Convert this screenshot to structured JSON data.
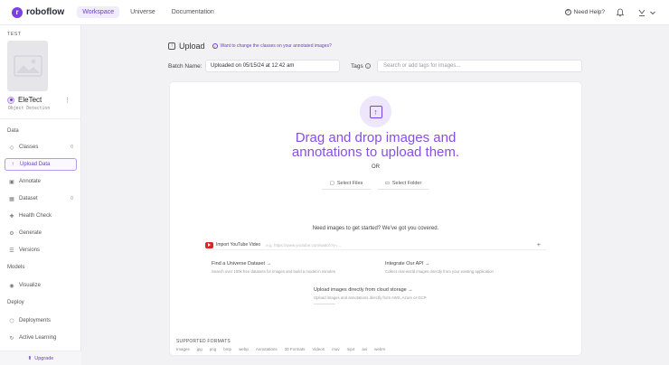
{
  "app": {
    "logo_text": "roboflow",
    "brand_color": "#7b3fe4"
  },
  "nav": {
    "tabs": [
      {
        "label": "Workspace",
        "active": true
      },
      {
        "label": "Universe",
        "active": false
      },
      {
        "label": "Documentation",
        "active": false
      }
    ],
    "help_label": "Need Help?"
  },
  "sidebar": {
    "workspace_label": "TEST",
    "project_name": "EleTect",
    "project_type": "Object Detection",
    "sections": {
      "data": "Data",
      "models": "Models",
      "deploy": "Deploy"
    },
    "items": [
      {
        "label": "Classes",
        "icon": "tag-icon",
        "badge": "0"
      },
      {
        "label": "Upload Data",
        "icon": "upload-icon",
        "active": true
      },
      {
        "label": "Annotate",
        "icon": "annotate-icon"
      },
      {
        "label": "Dataset",
        "icon": "dataset-icon",
        "badge": "0"
      },
      {
        "label": "Health Check",
        "icon": "health-icon"
      },
      {
        "label": "Generate",
        "icon": "generate-icon"
      },
      {
        "label": "Versions",
        "icon": "versions-icon"
      },
      {
        "label": "Visualize",
        "icon": "visualize-icon"
      },
      {
        "label": "Deployments",
        "icon": "deployments-icon"
      },
      {
        "label": "Active Learning",
        "icon": "active-learning-icon"
      }
    ],
    "upgrade_label": "Upgrade"
  },
  "main": {
    "title": "Upload",
    "hint": "Want to change the classes on your annotated images?",
    "batch_label": "Batch Name:",
    "batch_value": "Uploaded on 05/15/24 at 12:42 am",
    "tags_label": "Tags",
    "tags_placeholder": "Search or add tags for images...",
    "dropzone": {
      "title": "Drag and drop images and annotations to upload them.",
      "or": "OR",
      "select_files": "Select Files",
      "select_folder": "Select Folder"
    },
    "need_images": "Need images to get started? We've got you covered.",
    "youtube": {
      "label": "Import YouTube Video",
      "placeholder": "e.g. https://www.youtube.com/watch?v=..."
    },
    "cards": [
      {
        "title": "Find a Universe Dataset →",
        "desc": "Search over 100k free datasets for images and build a model in minutes"
      },
      {
        "title": "Integrate Our API →",
        "desc": "Collect real-world images directly from your existing application"
      },
      {
        "title": "Upload images directly from cloud storage →",
        "desc": "Upload images and annotations directly from AWS, Azure or GCP"
      }
    ],
    "formats_label": "SUPPORTED FORMATS",
    "formats": [
      "Images",
      "jpg",
      "png",
      "bmp",
      "webp",
      "Annotations",
      "30 Formats",
      "Videos",
      "mov",
      "mp4",
      "avi",
      "webm"
    ]
  }
}
